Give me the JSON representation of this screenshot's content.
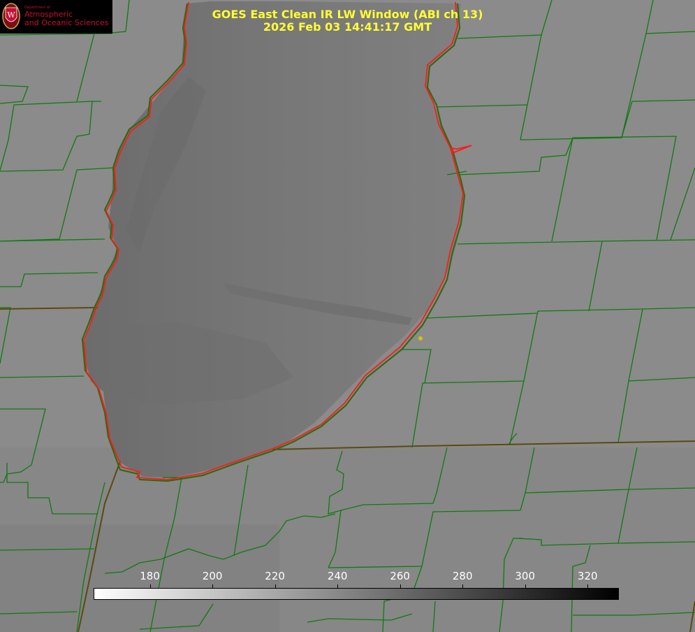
{
  "title_line1": "GOES East Clean IR LW Window (ABI ch 13)",
  "title_line2": "2026 Feb 03 14:41:17 GMT",
  "logo": {
    "dept_small": "Department of",
    "line1": "Atmospheric",
    "line2": "and Oceanic Sciences",
    "seal_letter": "W"
  },
  "colorbar": {
    "ticks": [
      "180",
      "200",
      "220",
      "240",
      "260",
      "280",
      "300",
      "320"
    ],
    "tick_values": [
      180,
      200,
      220,
      240,
      260,
      280,
      300,
      320
    ],
    "min": 162,
    "max": 330,
    "gradient_from": "#ffffff",
    "gradient_to": "#000000"
  },
  "colors": {
    "county_lines": "#0f7a0f",
    "coastline": "#ff1a1a",
    "title_text": "#ffff33",
    "marker": "#d4c400",
    "lake": "#7a7a7a",
    "land": "#8a8a8a"
  }
}
